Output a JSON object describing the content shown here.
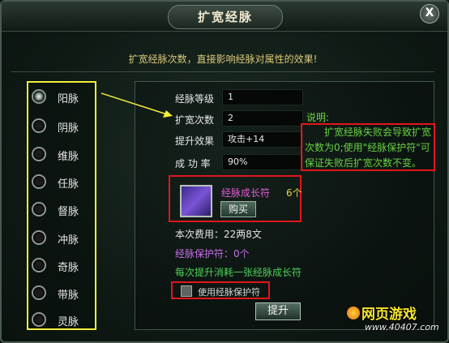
{
  "window": {
    "title": "扩宽经脉",
    "close_label": "X"
  },
  "subtitle": "扩宽经脉次数，直接影响经脉对属性的效果!",
  "meridians": [
    {
      "label": "阳脉",
      "selected": true
    },
    {
      "label": "阴脉",
      "selected": false
    },
    {
      "label": "维脉",
      "selected": false
    },
    {
      "label": "任脉",
      "selected": false
    },
    {
      "label": "督脉",
      "selected": false
    },
    {
      "label": "冲脉",
      "selected": false
    },
    {
      "label": "奇脉",
      "selected": false
    },
    {
      "label": "带脉",
      "selected": false
    },
    {
      "label": "灵脉",
      "selected": false
    }
  ],
  "stats": {
    "level_label": "经脉等级",
    "level_value": "1",
    "expand_label": "扩宽次数",
    "expand_value": "2",
    "effect_label": "提升效果",
    "effect_value": "攻击+14",
    "rate_label": "成 功 率",
    "rate_value": "90%"
  },
  "note": {
    "title": "说明:",
    "text": "扩宽经脉失败会导致扩宽次数为0;使用\"经脉保护符\"可保证失败后扩宽次数不变。"
  },
  "item": {
    "name": "经脉成长符",
    "count": "6个",
    "buy_label": "购买"
  },
  "cost_text": "本次费用：22两8文",
  "protect_text": "经脉保护符：0个",
  "consume_text": "每次提升消耗一张经脉成长符",
  "use_protect_label": "使用经脉保护符",
  "upgrade_label": "提升",
  "watermark": {
    "logo": "网页游戏",
    "url": "www.40407.com"
  },
  "colors": {
    "highlight_yellow": "#f2ee3a",
    "highlight_red": "#e0161b",
    "note_green": "#67d143",
    "item_pink": "#e85bd6",
    "protect_purple": "#c86ee8",
    "consume_green": "#4fd15a"
  }
}
